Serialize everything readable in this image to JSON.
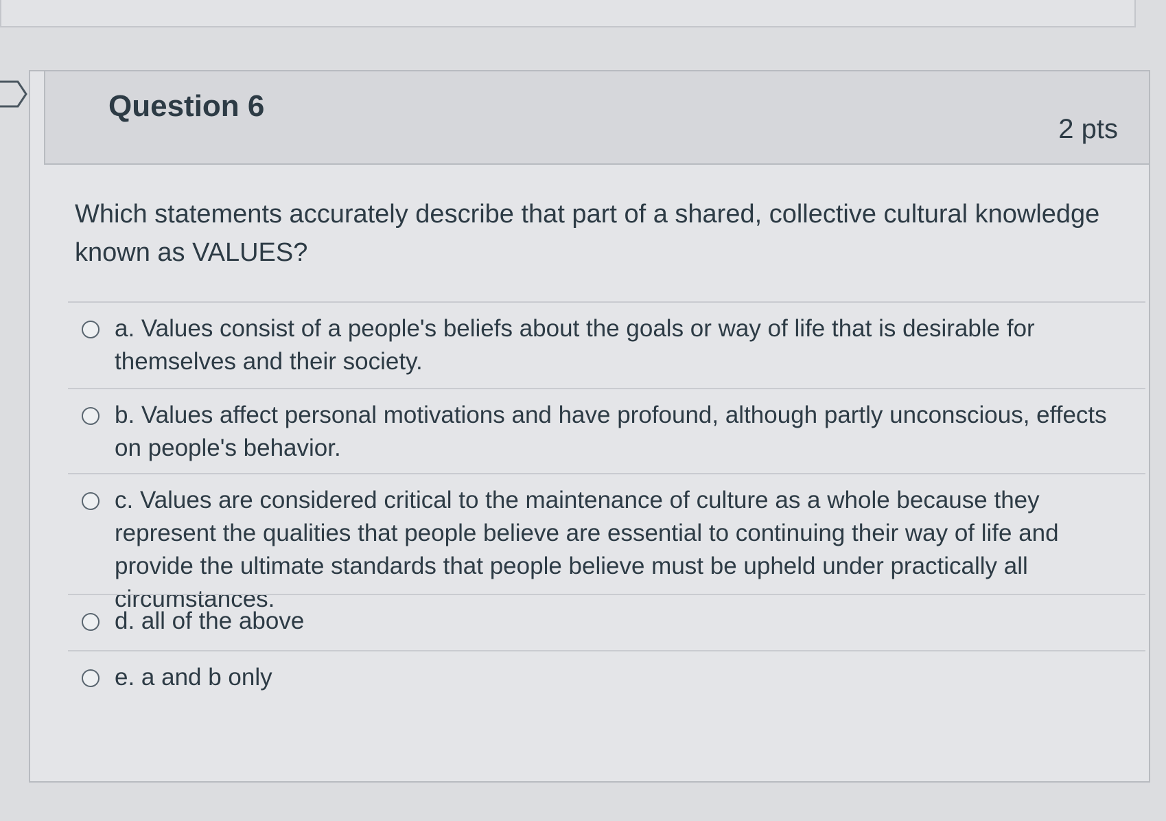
{
  "question": {
    "title": "Question 6",
    "points": "2 pts",
    "text": "Which statements accurately describe that part of a shared, collective cultural knowledge known as VALUES?"
  },
  "answers": [
    {
      "label": "a. Values consist of a people's beliefs about the goals or way of life that is desirable for themselves and their society.",
      "selected": false
    },
    {
      "label": "b. Values affect personal motivations and have profound, although partly unconscious, effects on people's behavior.",
      "selected": false
    },
    {
      "label": "c. Values are considered critical to the maintenance of culture as a whole because they represent the qualities that people believe are essential to continuing their way of life and provide the ultimate standards that people believe must be upheld under practically all circumstances.",
      "selected": false
    },
    {
      "label": "d. all of the above",
      "selected": false
    },
    {
      "label": "e. a and b only",
      "selected": false
    }
  ],
  "colors": {
    "text": "#2d3b45",
    "card_background": "#e4e5e8",
    "header_background": "#d6d7db"
  },
  "icons": {
    "bookmark": "bookmark-flag-icon",
    "radio": "radio-button-icon"
  }
}
